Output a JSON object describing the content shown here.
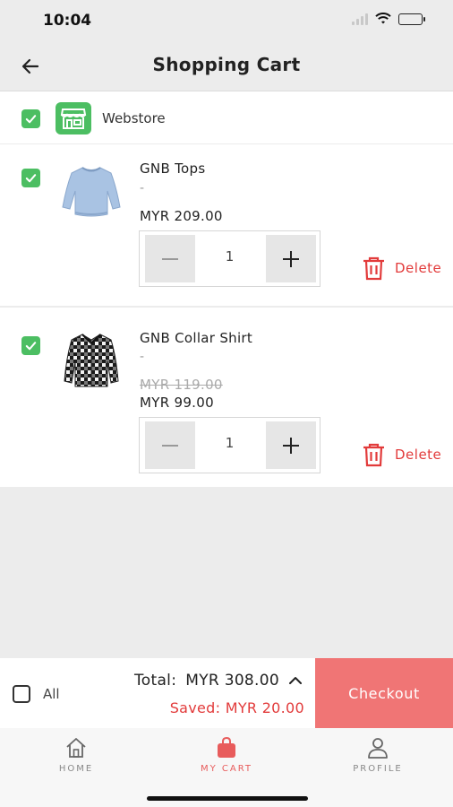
{
  "status_bar": {
    "time": "10:04"
  },
  "header": {
    "title": "Shopping Cart"
  },
  "store": {
    "name": "Webstore"
  },
  "cart": {
    "items": [
      {
        "name": "GNB Tops",
        "variant": "-",
        "price": "MYR 209.00",
        "quantity": "1",
        "delete_label": "Delete"
      },
      {
        "name": "GNB Collar Shirt",
        "variant": "-",
        "original_price": "MYR 119.00",
        "price": "MYR 99.00",
        "quantity": "1",
        "delete_label": "Delete"
      }
    ]
  },
  "summary": {
    "select_all_label": "All",
    "total_label": "Total:",
    "total_amount": "MYR 308.00",
    "saved_text": "Saved: MYR 20.00",
    "checkout_label": "Checkout"
  },
  "tab_bar": {
    "tabs": [
      {
        "label": "HOME",
        "icon": "home-icon"
      },
      {
        "label": "MY CART",
        "icon": "bag-icon",
        "active": true
      },
      {
        "label": "PROFILE",
        "icon": "person-icon"
      }
    ]
  },
  "colors": {
    "check_green": "#4cbe62",
    "delete_red": "#e23b3b",
    "checkout_bg": "#f07575",
    "active_tab": "#e85c5c"
  }
}
